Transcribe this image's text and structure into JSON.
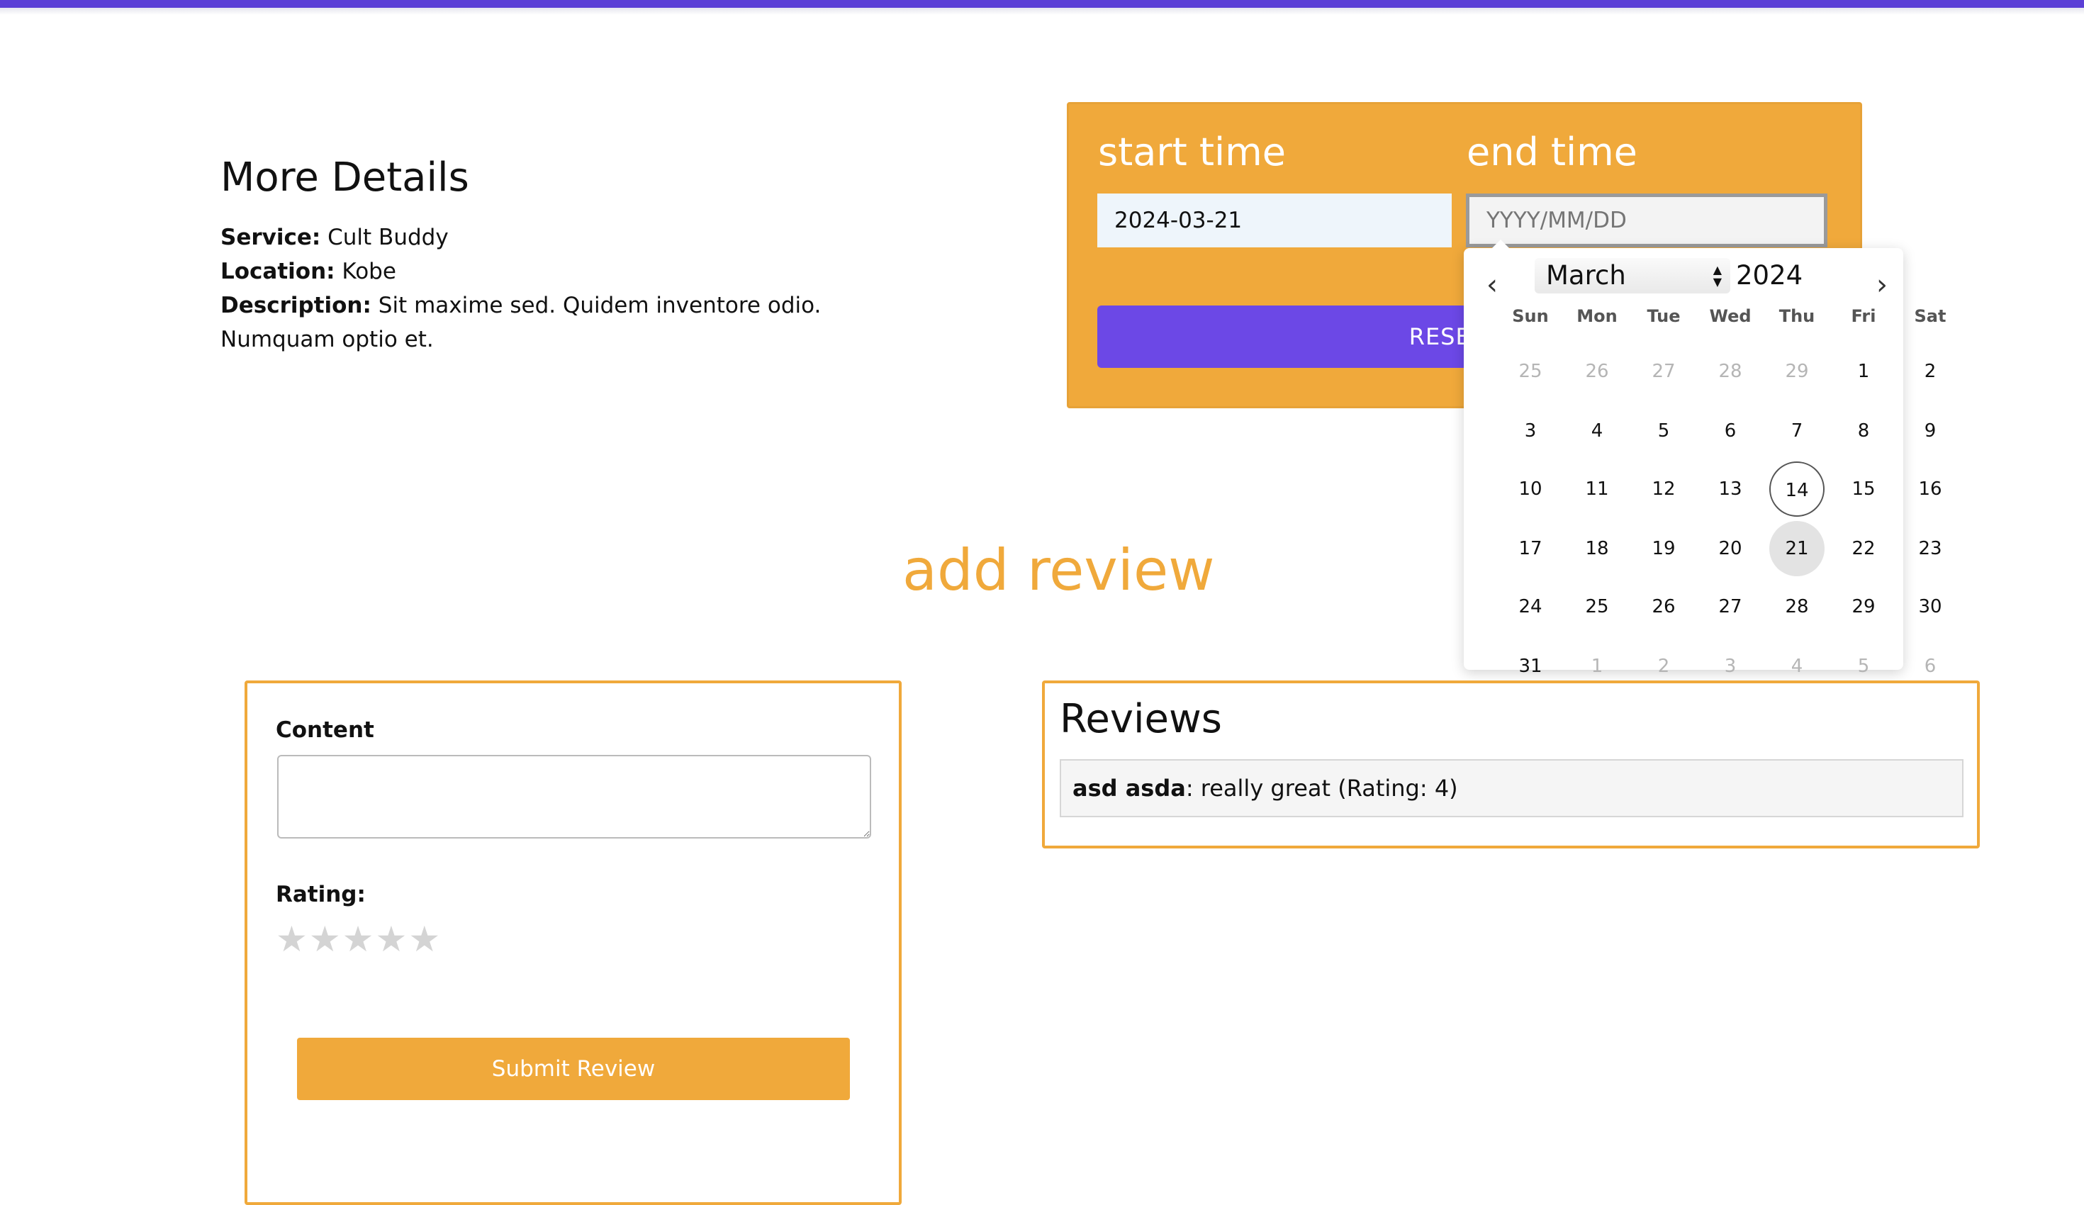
{
  "details": {
    "title": "More Details",
    "service_label": "Service:",
    "service_value": "Cult Buddy",
    "location_label": "Location:",
    "location_value": "Kobe",
    "description_label": "Description:",
    "description_value": "Sit maxime sed. Quidem inventore odio. Numquam optio et."
  },
  "booking": {
    "start_label": "start time",
    "end_label": "end time",
    "start_value": "2024-03-21",
    "end_placeholder": "YYYY/MM/DD",
    "reserve_label": "RESERVE",
    "accent_color": "#f0a93b",
    "button_color": "#6c48e6"
  },
  "calendar": {
    "month": "March",
    "year": "2024",
    "prev_icon": "chevron-left-icon",
    "next_icon": "chevron-right-icon",
    "weekdays": [
      "Sun",
      "Mon",
      "Tue",
      "Wed",
      "Thu",
      "Fri",
      "Sat"
    ],
    "weeks": [
      [
        "25",
        "26",
        "27",
        "28",
        "29",
        "1",
        "2"
      ],
      [
        "3",
        "4",
        "5",
        "6",
        "7",
        "8",
        "9"
      ],
      [
        "10",
        "11",
        "12",
        "13",
        "14",
        "15",
        "16"
      ],
      [
        "17",
        "18",
        "19",
        "20",
        "21",
        "22",
        "23"
      ],
      [
        "24",
        "25",
        "26",
        "27",
        "28",
        "29",
        "30"
      ],
      [
        "31",
        "1",
        "2",
        "3",
        "4",
        "5",
        "6"
      ]
    ],
    "today": "14",
    "selected": "21"
  },
  "add_review": {
    "title": "add review",
    "content_label": "Content",
    "rating_label": "Rating:",
    "rating_stars": 5,
    "rating_value": 0,
    "submit_label": "Submit Review"
  },
  "reviews": {
    "title": "Reviews",
    "items": [
      {
        "author": "asd asda",
        "text": ": really great (Rating: 4)"
      }
    ]
  }
}
